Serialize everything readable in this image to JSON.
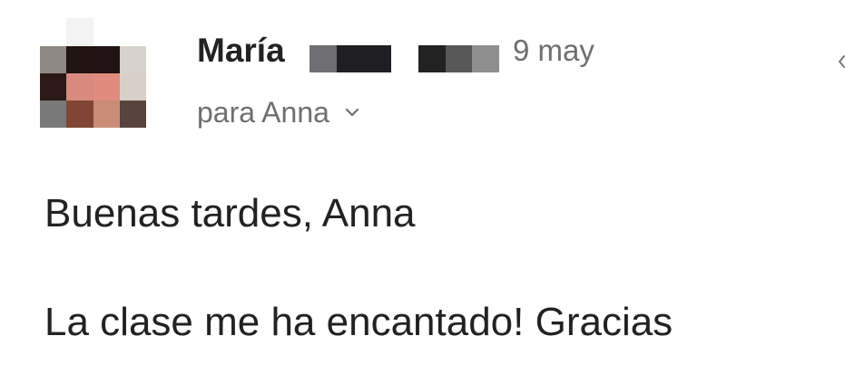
{
  "email": {
    "sender_name": "María",
    "date": "9 may",
    "recipients_label": "para Anna",
    "body": {
      "greeting": "Buenas tardes, Anna",
      "message": "La clase me ha encantado! Gracias"
    }
  },
  "colors": {
    "text_primary": "#222222",
    "text_secondary": "#6f6f6f",
    "redaction_dark": "#1f1f22",
    "redaction_mid": "#575757",
    "redaction_light": "#8f8f8f"
  },
  "icons": {
    "avatar": "pixelated-avatar",
    "recipients_toggle": "chevron-down-icon",
    "edge_control": "left-arrow-icon"
  }
}
